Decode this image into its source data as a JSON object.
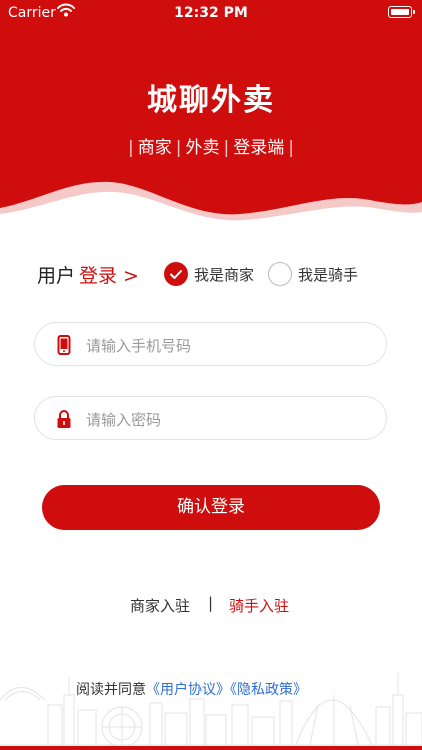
{
  "status_bar": {
    "carrier": "Carrier",
    "time": "12:32 PM"
  },
  "header": {
    "title": "城聊外卖",
    "subtitle_items": [
      "商家",
      "外卖",
      "登录端"
    ],
    "subtitle_separator": "|"
  },
  "login_type": {
    "prefix": "用户",
    "highlight": "登录 >",
    "options": [
      {
        "label": "我是商家",
        "selected": true
      },
      {
        "label": "我是骑手",
        "selected": false
      }
    ]
  },
  "form": {
    "phone_placeholder": "请输入手机号码",
    "password_placeholder": "请输入密码",
    "confirm_label": "确认登录"
  },
  "entries": {
    "merchant": "商家入驻",
    "separator": "|",
    "rider": "骑手入驻"
  },
  "agreement": {
    "text": "阅读并同意",
    "user_agreement": "《用户协议》",
    "privacy_policy": "《隐私政策》"
  },
  "colors": {
    "brand_red": "#d00d0d",
    "link_blue": "#2f6fd6",
    "placeholder_gray": "#9a9a9a"
  },
  "icons": [
    "wifi-icon",
    "battery-icon",
    "phone-icon",
    "lock-icon",
    "check-icon"
  ]
}
